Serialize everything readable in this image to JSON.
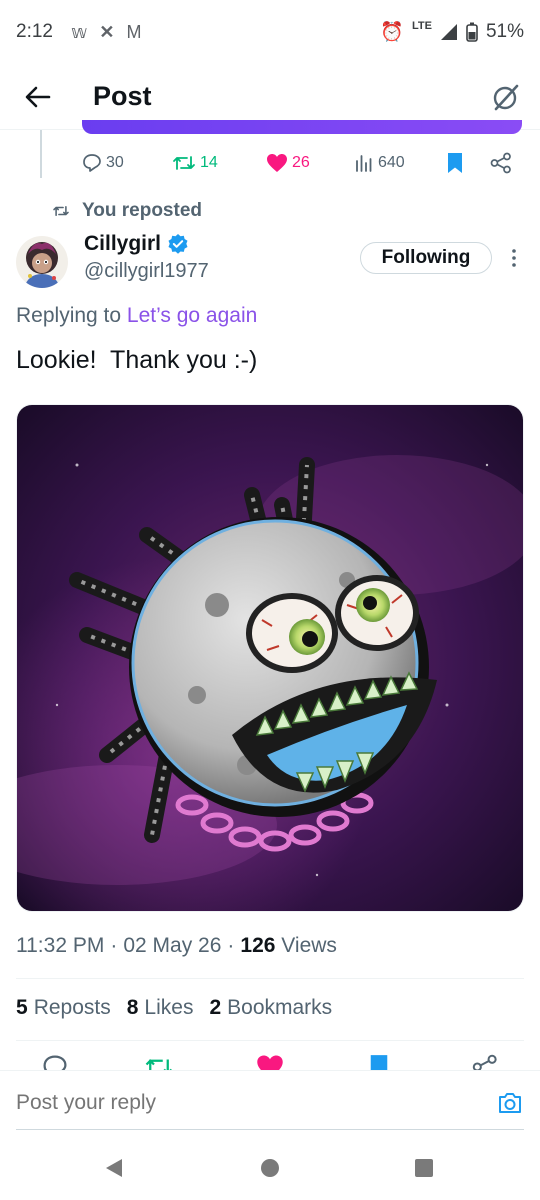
{
  "status_bar": {
    "time": "2:12",
    "network": "LTE",
    "battery": "51%",
    "notification_icons": [
      "wordle-icon",
      "x-icon",
      "gmail-icon"
    ]
  },
  "header": {
    "title": "Post"
  },
  "parent_actions": {
    "replies": "30",
    "reposts": "14",
    "likes": "26",
    "views": "640"
  },
  "repost_context": {
    "label": "You reposted"
  },
  "author": {
    "display_name": "Cillygirl",
    "handle": "@cillygirl1977",
    "verified": true,
    "follow_label": "Following"
  },
  "tweet": {
    "replying_prefix": "Replying to",
    "replying_to": "Let’s go again",
    "text": "Lookie!  Thank you :-)",
    "time": "11:32 PM",
    "date": "02 May 26",
    "views_count": "126",
    "views_label": "Views"
  },
  "stats": {
    "reposts_count": "5",
    "reposts_label": "Reposts",
    "likes_count": "8",
    "likes_label": "Likes",
    "bookmarks_count": "2",
    "bookmarks_label": "Bookmarks"
  },
  "reply_bar": {
    "placeholder": "Post your reply"
  },
  "colors": {
    "accent_blue": "#1d9bf0",
    "repost_green": "#00ba7c",
    "like_pink": "#f91880",
    "link_purple": "#8a52e8",
    "secondary_text": "#536471"
  }
}
